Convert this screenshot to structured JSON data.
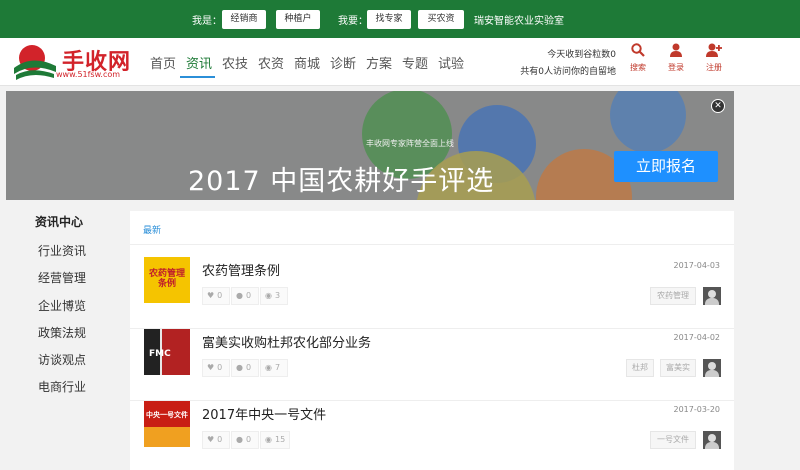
{
  "topbar": {
    "i_am_label": "我是：",
    "i_am_buttons": [
      "经销商",
      "种植户"
    ],
    "i_want_label": "我要：",
    "i_want_buttons": [
      "找专家",
      "买农资"
    ],
    "lab_text": "瑞安智能农业实验室"
  },
  "header": {
    "logo_text": "手收网",
    "logo_url": "www.51fsw.com",
    "nav": [
      "首页",
      "资讯",
      "农技",
      "农资",
      "商城",
      "诊断",
      "方案",
      "专题",
      "试验"
    ],
    "active_nav": "资讯",
    "stat_line1": "今天收到谷粒数0",
    "stat_line2": "共有0人访问你的自留地",
    "icons": [
      {
        "icon": "search-icon",
        "label": "搜索"
      },
      {
        "icon": "user-icon",
        "label": "登录"
      },
      {
        "icon": "user-plus-icon",
        "label": "注册"
      }
    ],
    "colors": {
      "brand_green": "#1e7a37",
      "accent_red": "#d2232a",
      "active_blue": "#2b8fd8"
    }
  },
  "banner": {
    "subtitle": "丰收网专家阵营全面上线",
    "title": "2017 中国农耕好手评选",
    "button": "立即报名",
    "close": "✕"
  },
  "sidebar": {
    "title": "资讯中心",
    "items": [
      "行业资讯",
      "经营管理",
      "企业博览",
      "政策法规",
      "访谈观点",
      "电商行业"
    ]
  },
  "main": {
    "section_label": "最新",
    "articles": [
      {
        "title": "农药管理条例",
        "date": "2017-04-03",
        "likes": "0",
        "comments": "0",
        "views": "3",
        "tags": [
          "农药管理"
        ],
        "thumb_text": "农药管理条例"
      },
      {
        "title": "富美实收购杜邦农化部分业务",
        "date": "2017-04-02",
        "likes": "0",
        "comments": "0",
        "views": "7",
        "tags": [
          "杜邦",
          "富美实"
        ],
        "thumb_text": "FMC"
      },
      {
        "title": "2017年中央一号文件",
        "date": "2017-03-20",
        "likes": "0",
        "comments": "0",
        "views": "15",
        "tags": [
          "一号文件"
        ],
        "thumb_text": "中央一号文件"
      }
    ]
  }
}
